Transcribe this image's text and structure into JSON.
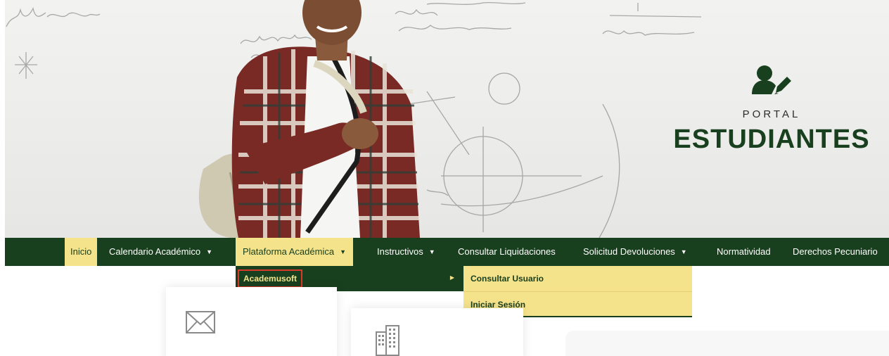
{
  "hero": {
    "portal_label": "PORTAL",
    "title": "ESTUDIANTES",
    "icon": "user-edit-icon",
    "title_color": "#19401e"
  },
  "nav": {
    "background": "#19401e",
    "highlight": "#f5e38c",
    "items": [
      {
        "label": "Inicio",
        "caret": false
      },
      {
        "label": "Calendario Académico",
        "caret": true
      },
      {
        "label": "Plataforma Académica",
        "caret": true
      },
      {
        "label": "Instructivos",
        "caret": true
      },
      {
        "label": "Consultar Liquidaciones",
        "caret": false
      },
      {
        "label": "Solicitud Devoluciones",
        "caret": true
      },
      {
        "label": "Normatividad",
        "caret": false
      },
      {
        "label": "Derechos Pecuniario",
        "caret": false
      }
    ]
  },
  "dropdown": {
    "level1": [
      {
        "label": "Academusoft"
      }
    ],
    "level2": [
      {
        "label": "Consultar Usuario"
      },
      {
        "label": "Iniciar Sesión"
      }
    ]
  },
  "cards": [
    {
      "icon": "mail-icon"
    },
    {
      "icon": "building-icon"
    }
  ]
}
